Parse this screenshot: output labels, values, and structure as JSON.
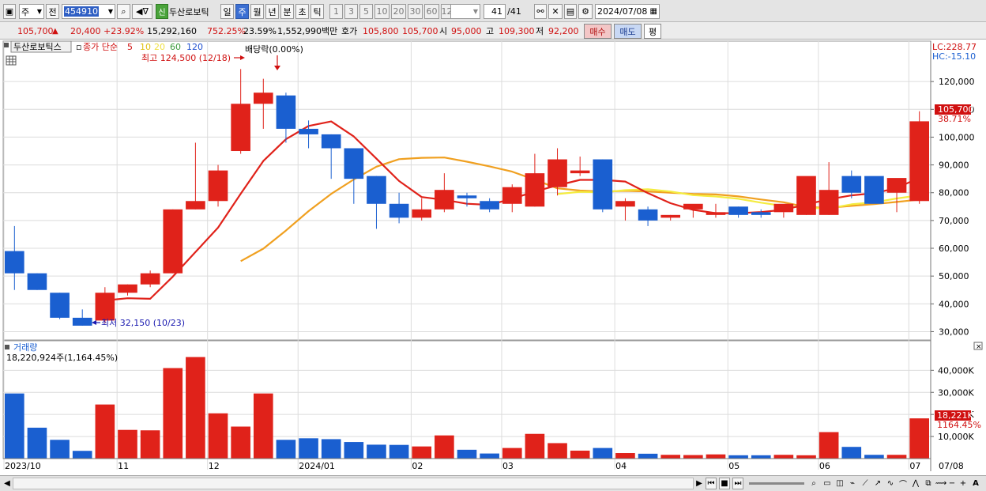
{
  "toolbar": {
    "period_select": "주",
    "prev_label": "전",
    "stock_code": "454910",
    "new_badge": "신",
    "stock_name": "두산로보틱",
    "period_tabs": [
      "일",
      "주",
      "월",
      "년",
      "분",
      "초",
      "틱"
    ],
    "selected_period": "주",
    "interval_buttons": [
      "1",
      "3",
      "5",
      "10",
      "20",
      "30",
      "60",
      "120"
    ],
    "page_counter": "41",
    "page_total": "/41",
    "date": "2024/07/08"
  },
  "quote": {
    "price": "105,700",
    "change_arrow": "▲",
    "change": "20,400",
    "change_pct": "+23.92%",
    "volume": "15,292,160",
    "vol_ratio": "752.25%",
    "turnover": "23.59%",
    "amount": "1,552,990백만",
    "hoga_label": "호가",
    "ask": "105,800",
    "bid": "105,700",
    "open_label": "시",
    "open": "95,000",
    "high_label": "고",
    "high": "109,300",
    "low_label": "저",
    "low": "92,200",
    "buy_label": "매수",
    "sell_label": "매도",
    "flat_label": "평"
  },
  "chart_panel": {
    "stock_label": "두산로보틱스",
    "ma_title": "종가 단순",
    "ma_periods": [
      "5",
      "10",
      "20",
      "60",
      "120"
    ],
    "ma_colors": [
      "#d01010",
      "#e0c010",
      "#f0e040",
      "#3a9a3a",
      "#2050d0"
    ],
    "dividend_annotation": "배당락(0.00%)",
    "max_annotation": "최고 124,500 (12/18)",
    "min_annotation": "최저 32,150 (10/23)",
    "lc_label": "LC:228.77",
    "hc_label": "HC:-15.10",
    "last_price_tag": "105,700",
    "last_pct_tag": "38.71%",
    "y_ticks": [
      "120,000",
      "110,000",
      "100,000",
      "90,000",
      "80,000",
      "70,000",
      "60,000",
      "50,000",
      "40,000",
      "30,000"
    ]
  },
  "volume_panel": {
    "title": "거래량",
    "subtitle": "18,220,924주(1,164.45%)",
    "y_ticks": [
      "40,000K",
      "30,000K",
      "20,000K",
      "10,000K"
    ],
    "last_tag": "18,221K",
    "last_pct": "1164.45%"
  },
  "x_labels": [
    "2023/10",
    "11",
    "12",
    "2024/01",
    "02",
    "03",
    "04",
    "05",
    "06",
    "07",
    "07/08"
  ],
  "colors": {
    "up": "#e0221a",
    "down": "#1a5fd0",
    "ma5": "#e0221a",
    "ma10": "#f4ec40",
    "ma20": "#f0a020"
  },
  "chart_data": {
    "type": "candlestick",
    "x": [
      "2023-10-02",
      "2023-10-09",
      "2023-10-16",
      "2023-10-23",
      "2023-10-30",
      "2023-11-06",
      "2023-11-13",
      "2023-11-20",
      "2023-11-27",
      "2023-12-04",
      "2023-12-11",
      "2023-12-18",
      "2023-12-25",
      "2024-01-01",
      "2024-01-08",
      "2024-01-15",
      "2024-01-22",
      "2024-01-29",
      "2024-02-05",
      "2024-02-12",
      "2024-02-19",
      "2024-02-26",
      "2024-03-04",
      "2024-03-11",
      "2024-03-18",
      "2024-03-25",
      "2024-04-01",
      "2024-04-08",
      "2024-04-15",
      "2024-04-22",
      "2024-04-29",
      "2024-05-06",
      "2024-05-13",
      "2024-05-20",
      "2024-05-27",
      "2024-06-03",
      "2024-06-10",
      "2024-06-17",
      "2024-06-24",
      "2024-07-01",
      "2024-07-08"
    ],
    "series": [
      {
        "name": "open",
        "values": [
          59000,
          51000,
          44000,
          35000,
          34000,
          44000,
          47000,
          51000,
          74000,
          77000,
          95000,
          112000,
          115000,
          103000,
          101000,
          96000,
          86000,
          76000,
          71000,
          74000,
          79000,
          77000,
          76000,
          75000,
          82000,
          87000,
          92000,
          75000,
          74000,
          71000,
          74000,
          72000,
          75000,
          73000,
          73000,
          72000,
          72000,
          86000,
          86000,
          80000,
          77000
        ]
      },
      {
        "name": "high",
        "values": [
          68000,
          51000,
          44000,
          38000,
          46000,
          47000,
          52000,
          74000,
          98000,
          90000,
          124500,
          121000,
          116000,
          106000,
          101000,
          96000,
          86000,
          80000,
          78000,
          87000,
          80000,
          78000,
          83000,
          94000,
          96000,
          93000,
          92000,
          78000,
          75000,
          72000,
          75000,
          76000,
          75000,
          74000,
          73000,
          75000,
          91000,
          88000,
          82000,
          81000,
          109300
        ]
      },
      {
        "name": "low",
        "values": [
          45000,
          45000,
          34500,
          32150,
          33000,
          43000,
          46000,
          51000,
          74000,
          75000,
          94000,
          103000,
          98000,
          96000,
          85000,
          76000,
          67000,
          69000,
          70000,
          73000,
          75000,
          73000,
          73000,
          75000,
          79000,
          86000,
          73000,
          70000,
          68000,
          70000,
          71000,
          71000,
          71000,
          71000,
          71000,
          72000,
          72000,
          78000,
          78000,
          73000,
          76000
        ]
      },
      {
        "name": "close",
        "values": [
          51000,
          45000,
          35000,
          32150,
          44000,
          47000,
          51000,
          74000,
          77000,
          88000,
          112000,
          116000,
          103000,
          101000,
          96000,
          85000,
          76000,
          71000,
          74000,
          81000,
          78000,
          74000,
          82000,
          87000,
          92000,
          88000,
          74000,
          77000,
          70000,
          72000,
          76000,
          73000,
          72000,
          72000,
          76000,
          86000,
          81000,
          80000,
          76000,
          85300,
          105700
        ]
      },
      {
        "name": "volume_k",
        "values": [
          29500,
          14000,
          8500,
          3500,
          24500,
          13000,
          12800,
          41000,
          46000,
          20500,
          14500,
          29500,
          8500,
          9200,
          8800,
          7500,
          6300,
          6200,
          5500,
          10500,
          4000,
          2300,
          4800,
          11200,
          7000,
          3600,
          4800,
          2500,
          2200,
          1700,
          1600,
          1900,
          1500,
          1500,
          1700,
          1500,
          12000,
          5300,
          1700,
          1700,
          18221
        ]
      },
      {
        "name": "MA5",
        "values": [
          null,
          null,
          null,
          null,
          41230,
          42030,
          41830,
          49830,
          58630,
          67430,
          79630,
          91430,
          99230,
          104030,
          105630,
          100230,
          92230,
          84230,
          78430,
          77430,
          76030,
          75630,
          77830,
          80430,
          82630,
          84630,
          84630,
          84030,
          79830,
          76230,
          73830,
          72630,
          72630,
          73030,
          73830,
          75830,
          77630,
          79030,
          79830,
          81660,
          85400
        ]
      },
      {
        "name": "MA10",
        "values": [
          null,
          null,
          null,
          null,
          null,
          null,
          null,
          null,
          null,
          null,
          null,
          null,
          null,
          null,
          null,
          null,
          null,
          null,
          null,
          null,
          null,
          null,
          null,
          null,
          79530,
          80330,
          80130,
          80930,
          81230,
          80430,
          79130,
          78630,
          77830,
          76430,
          75230,
          74530,
          74330,
          75830,
          76530,
          77930,
          79030
        ]
      },
      {
        "name": "MA20",
        "values": [
          null,
          null,
          null,
          null,
          null,
          null,
          null,
          null,
          null,
          null,
          55370,
          59870,
          66370,
          73370,
          79570,
          84770,
          89370,
          92070,
          92570,
          92670,
          91170,
          89470,
          87570,
          84670,
          81570,
          80770,
          80370,
          80670,
          80470,
          79970,
          79570,
          79370,
          78670,
          77570,
          76570,
          74870,
          74570,
          75270,
          75870,
          76670,
          77530
        ]
      }
    ],
    "ylim": [
      27000,
      130000
    ],
    "volume_ylim": [
      0,
      48000
    ],
    "title": "",
    "xlabel": "",
    "ylabel": ""
  }
}
